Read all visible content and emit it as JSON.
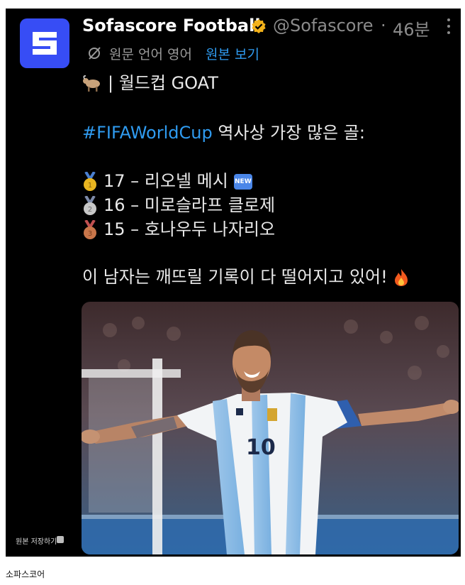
{
  "tweet": {
    "display_name": "Sofascore Football",
    "handle": "@Sofascore",
    "separator": "·",
    "time_ago": "46분",
    "translation": {
      "label": "원문 언어 영어",
      "show_original": "원본 보기"
    },
    "lines": {
      "title": "| 월드컵 GOAT",
      "hashtag": "#FIFAWorldCup",
      "heading_rest": " 역사상 가장 많은 골:",
      "rank1": "17 – 리오넬 메시",
      "rank2": "16 – 미로슬라프 클로제",
      "rank3": "15 – 호나우두 나자리오",
      "closing": "이 남자는 깨뜨릴 기록이 다 떨어지고 있어!"
    },
    "new_badge": "NEW",
    "icons": {
      "avatar": "sofascore-logo",
      "verified": "verified-badge-icon",
      "goat": "goat-emoji",
      "medals": [
        "gold-medal-emoji",
        "silver-medal-emoji",
        "bronze-medal-emoji"
      ],
      "fire": "fire-emoji",
      "translate": "translate-icon",
      "more": "more-vertical-icon"
    }
  },
  "screenshot": {
    "save_original": "원본 저장하기"
  },
  "caption": "소파스코어",
  "colors": {
    "background": "#000000",
    "brand": "#374df5",
    "link": "#2f9bf0",
    "muted": "#8b8b8b",
    "verified": "#f3b21a"
  }
}
